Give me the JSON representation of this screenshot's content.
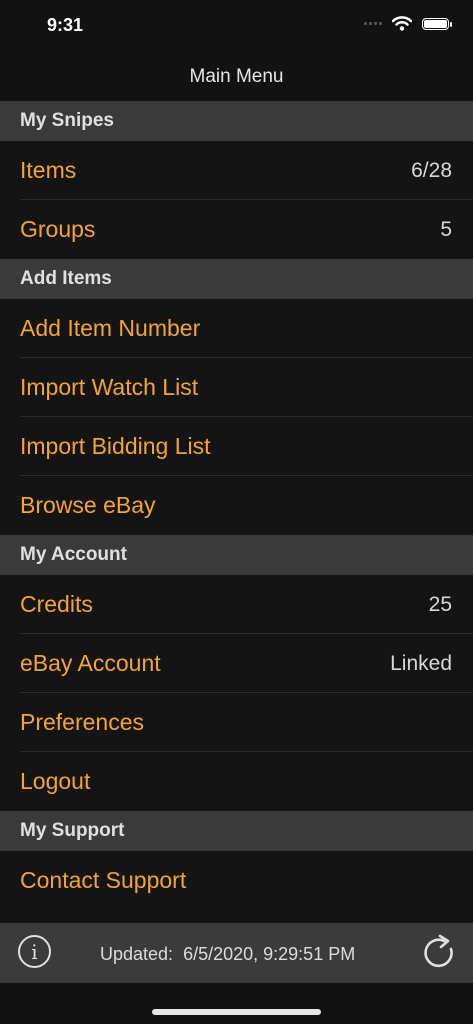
{
  "status": {
    "time": "9:31"
  },
  "nav": {
    "title": "Main Menu"
  },
  "sections": {
    "my_snipes": {
      "title": "My Snipes",
      "items_label": "Items",
      "items_value": "6/28",
      "groups_label": "Groups",
      "groups_value": "5"
    },
    "add_items": {
      "title": "Add Items",
      "add_number": "Add Item Number",
      "import_watch": "Import Watch List",
      "import_bidding": "Import Bidding List",
      "browse": "Browse eBay"
    },
    "my_account": {
      "title": "My Account",
      "credits_label": "Credits",
      "credits_value": "25",
      "ebay_label": "eBay Account",
      "ebay_value": "Linked",
      "preferences": "Preferences",
      "logout": "Logout"
    },
    "my_support": {
      "title": "My Support",
      "contact": "Contact Support"
    }
  },
  "toolbar": {
    "info_glyph": "i",
    "updated_label": "Updated:",
    "updated_value": "6/5/2020, 9:29:51 PM"
  },
  "colors": {
    "accent": "#f4a431",
    "header_bg": "#3a3a3a",
    "row_bg": "#141414"
  }
}
